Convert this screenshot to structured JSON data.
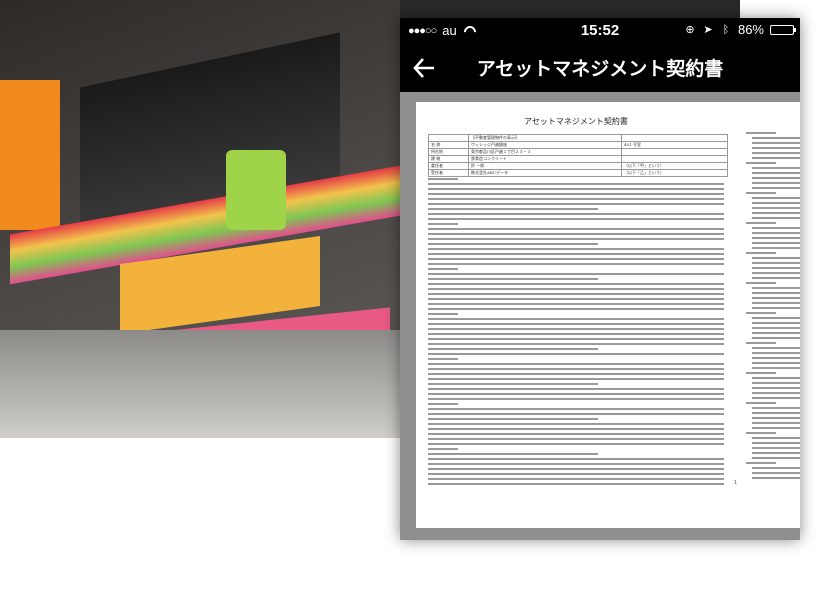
{
  "status_bar": {
    "signal": "●●●○○",
    "carrier": "au",
    "time": "15:52",
    "battery_level": "86%",
    "battery_fraction": 0.86
  },
  "nav": {
    "title": "アセットマネジメント契約書"
  },
  "document": {
    "title": "アセットマネジメント契約書",
    "page_number": "1",
    "table_rows": [
      [
        "",
        "【不動産管理物件の表示】",
        ""
      ],
      [
        "名 称",
        "ヴィレッジ戸越銀座",
        "401 号室"
      ],
      [
        "所在地",
        "東京都品川区戸越１丁目２３－３",
        ""
      ],
      [
        "建 物",
        "鉄骨造コンクリート",
        ""
      ],
      [
        "委任者",
        "鈴 一郎",
        "（以下「甲」という）"
      ],
      [
        "受任者",
        "株式会社ABCデータ",
        "（以下「乙」という）"
      ]
    ]
  },
  "colors": {
    "statusbar_bg": "#000000",
    "navbar_bg": "#000000",
    "viewer_bg": "#8f8f8f",
    "battery_fill": "#4cd964"
  }
}
